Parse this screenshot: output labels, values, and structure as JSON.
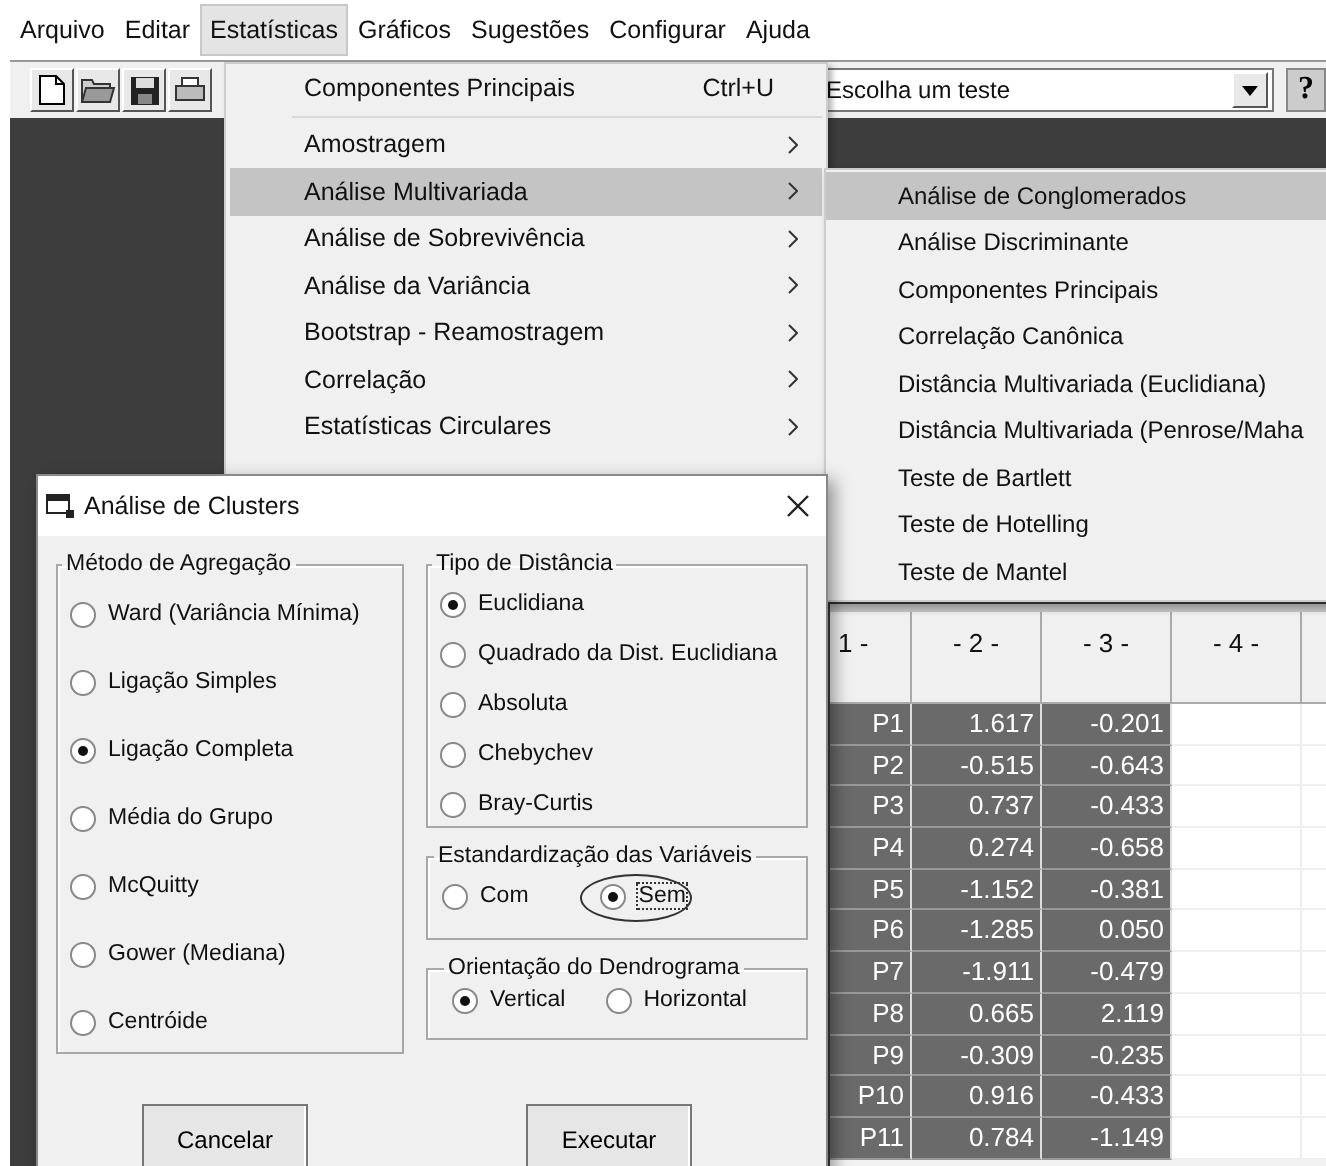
{
  "menu_bar": [
    {
      "label": "Arquivo",
      "selected": false
    },
    {
      "label": "Editar",
      "selected": false
    },
    {
      "label": "Estatísticas",
      "selected": true
    },
    {
      "label": "Gráficos",
      "selected": false
    },
    {
      "label": "Sugestões",
      "selected": false
    },
    {
      "label": "Configurar",
      "selected": false
    },
    {
      "label": "Ajuda",
      "selected": false
    }
  ],
  "toolbar": {
    "test_select": {
      "value": "Escolha um teste"
    },
    "help_button": "?"
  },
  "menu": [
    {
      "kind": "command",
      "label": "Componentes Principais",
      "shortcut": "Ctrl+U",
      "selected": false
    },
    {
      "kind": "separator"
    },
    {
      "kind": "submenu",
      "label": "Amostragem",
      "selected": false
    },
    {
      "kind": "submenu",
      "label": "Análise Multivariada",
      "selected": true
    },
    {
      "kind": "submenu",
      "label": "Análise de Sobrevivência",
      "selected": false
    },
    {
      "kind": "submenu",
      "label": "Análise da Variância",
      "selected": false
    },
    {
      "kind": "submenu",
      "label": "Bootstrap - Reamostragem",
      "selected": false
    },
    {
      "kind": "submenu",
      "label": "Correlação",
      "selected": false
    },
    {
      "kind": "submenu",
      "label": "Estatísticas Circulares",
      "selected": false
    }
  ],
  "submenu": [
    {
      "label": "Análise de Conglomerados",
      "selected": true
    },
    {
      "label": "Análise Discriminante",
      "selected": false
    },
    {
      "label": "Componentes Principais",
      "selected": false
    },
    {
      "label": "Correlação Canônica",
      "selected": false
    },
    {
      "label": "Distância Multivariada (Euclidiana)",
      "selected": false
    },
    {
      "label": "Distância Multivariada (Penrose/Maha",
      "selected": false
    },
    {
      "label": "Teste de Bartlett",
      "selected": false
    },
    {
      "label": "Teste de Hotelling",
      "selected": false
    },
    {
      "label": "Teste de Mantel",
      "selected": false
    }
  ],
  "table": {
    "columns": [
      "1 -",
      "- 2 -",
      "- 3 -",
      "- 4 -"
    ],
    "rows": [
      {
        "label": "P1",
        "values": [
          "1.617",
          "-0.201"
        ]
      },
      {
        "label": "P2",
        "values": [
          "-0.515",
          "-0.643"
        ]
      },
      {
        "label": "P3",
        "values": [
          "0.737",
          "-0.433"
        ]
      },
      {
        "label": "P4",
        "values": [
          "0.274",
          "-0.658"
        ]
      },
      {
        "label": "P5",
        "values": [
          "-1.152",
          "-0.381"
        ]
      },
      {
        "label": "P6",
        "values": [
          "-1.285",
          "0.050"
        ]
      },
      {
        "label": "P7",
        "values": [
          "-1.911",
          "-0.479"
        ]
      },
      {
        "label": "P8",
        "values": [
          "0.665",
          "2.119"
        ]
      },
      {
        "label": "P9",
        "values": [
          "-0.309",
          "-0.235"
        ]
      },
      {
        "label": "P10",
        "values": [
          "0.916",
          "-0.433"
        ]
      },
      {
        "label": "P11",
        "values": [
          "0.784",
          "-1.149"
        ]
      }
    ]
  },
  "dialog": {
    "title": "Análise de Clusters",
    "aggregation": {
      "title": "Método de Agregação",
      "options": [
        {
          "label": "Ward (Variância Mínima)",
          "selected": false
        },
        {
          "label": "Ligação Simples",
          "selected": false
        },
        {
          "label": "Ligação Completa",
          "selected": true
        },
        {
          "label": "Média do Grupo",
          "selected": false
        },
        {
          "label": "McQuitty",
          "selected": false
        },
        {
          "label": "Gower (Mediana)",
          "selected": false
        },
        {
          "label": "Centróide",
          "selected": false
        }
      ]
    },
    "distance": {
      "title": "Tipo de Distância",
      "options": [
        {
          "label": "Euclidiana",
          "selected": true
        },
        {
          "label": "Quadrado da Dist. Euclidiana",
          "selected": false
        },
        {
          "label": "Absoluta",
          "selected": false
        },
        {
          "label": "Chebychev",
          "selected": false
        },
        {
          "label": "Bray-Curtis",
          "selected": false
        }
      ]
    },
    "standardization": {
      "title": "Estandardização das Variáveis",
      "options": [
        {
          "label": "Com",
          "selected": false,
          "circled": false
        },
        {
          "label": "Sem",
          "selected": true,
          "circled": true
        }
      ]
    },
    "orientation": {
      "title": "Orientação do Dendrograma",
      "options": [
        {
          "label": "Vertical",
          "selected": true
        },
        {
          "label": "Horizontal",
          "selected": false
        }
      ]
    },
    "buttons": [
      "Cancelar",
      "Executar"
    ]
  }
}
